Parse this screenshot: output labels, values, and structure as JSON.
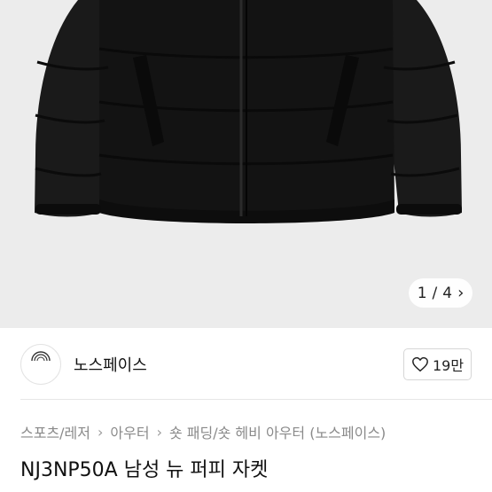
{
  "image_counter": {
    "current": "1",
    "separator": "/",
    "total": "4",
    "next_icon": "chevron-right-icon"
  },
  "shop": {
    "logo_text": "THE NORTH FACE",
    "name": "노스페이스"
  },
  "like": {
    "icon": "heart-outline-icon",
    "count": "19만"
  },
  "breadcrumb": {
    "items": [
      "스포츠/레저",
      "아우터",
      "숏 패딩/숏 헤비 아우터 (노스페이스)"
    ],
    "separator": "›"
  },
  "product": {
    "title": "NJ3NP50A 남성 뉴 퍼피 자켓"
  },
  "colors": {
    "hero_bg": "#ececec",
    "jacket": "#151515",
    "accent_text": "#8a8a8a"
  }
}
